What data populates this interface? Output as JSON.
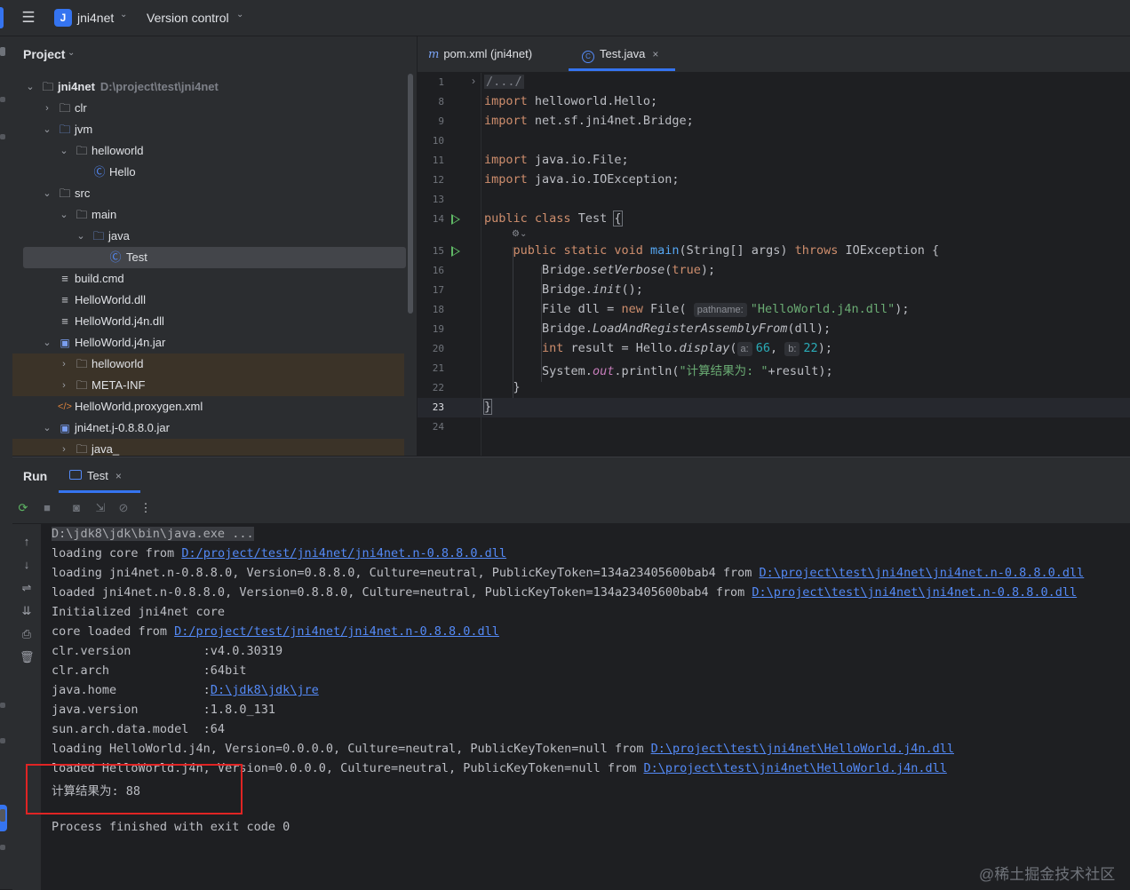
{
  "topbar": {
    "project_badge": "J",
    "project_name": "jni4net",
    "vcs_label": "Version control",
    "menu_icon": "hamburger-menu-icon",
    "chevron_icon": "chevron-down-icon"
  },
  "project_panel": {
    "title": "Project",
    "tree": [
      {
        "label": "jni4net",
        "path": "D:\\project\\test\\jni4net",
        "icon": "folder-module-icon",
        "expanded": true
      },
      {
        "label": "clr",
        "icon": "folder-icon",
        "expanded": false
      },
      {
        "label": "jvm",
        "icon": "folder-source-icon",
        "expanded": true
      },
      {
        "label": "helloworld",
        "icon": "package-icon",
        "expanded": true
      },
      {
        "label": "Hello",
        "icon": "java-class-icon"
      },
      {
        "label": "src",
        "icon": "folder-icon",
        "expanded": true
      },
      {
        "label": "main",
        "icon": "folder-icon",
        "expanded": true
      },
      {
        "label": "java",
        "icon": "folder-source-icon",
        "expanded": true
      },
      {
        "label": "Test",
        "icon": "java-class-icon",
        "selected": true
      },
      {
        "label": "build.cmd",
        "icon": "text-file-icon"
      },
      {
        "label": "HelloWorld.dll",
        "icon": "text-file-icon"
      },
      {
        "label": "HelloWorld.j4n.dll",
        "icon": "text-file-icon"
      },
      {
        "label": "HelloWorld.j4n.jar",
        "icon": "jar-icon",
        "expanded": true
      },
      {
        "label": "helloworld",
        "icon": "folder-icon",
        "expanded": false
      },
      {
        "label": "META-INF",
        "icon": "folder-icon",
        "expanded": false
      },
      {
        "label": "HelloWorld.proxygen.xml",
        "icon": "xml-file-icon"
      },
      {
        "label": "jni4net.j-0.8.8.0.jar",
        "icon": "jar-icon",
        "expanded": true
      },
      {
        "label": "java_",
        "icon": "folder-icon",
        "expanded": false
      }
    ]
  },
  "editor_tabs": [
    {
      "label": "pom.xml (jni4net)",
      "icon": "maven-icon"
    },
    {
      "label": "Test.java",
      "icon": "java-class-icon",
      "active": true,
      "close": "×"
    }
  ],
  "editor": {
    "line_numbers": [
      "1",
      "8",
      "9",
      "10",
      "11",
      "12",
      "13",
      "14",
      "15",
      "16",
      "17",
      "18",
      "19",
      "20",
      "21",
      "22",
      "23",
      "24"
    ],
    "fold_text": "/.../",
    "imports": [
      "helloworld.Hello;",
      "net.sf.jni4net.Bridge;",
      "java.io.File;",
      "java.io.IOException;"
    ],
    "import_kw": "import",
    "class_line": {
      "kw1": "public",
      "kw2": "class",
      "name": "Test",
      "brace": "{"
    },
    "main_line": {
      "kw1": "public",
      "kw2": "static",
      "kw3": "void",
      "name": "main",
      "params": "(String[] args) ",
      "kw4": "throws",
      "rest": " IOException {"
    },
    "line16": {
      "obj": "Bridge.",
      "m": "setVerbose",
      "open": "(",
      "arg": "true",
      "close": ");"
    },
    "line17": {
      "obj": "Bridge.",
      "m": "init",
      "rest": "();"
    },
    "line18": {
      "pre": "File dll = ",
      "kw": "new",
      "ctor": " File(",
      "hint": "pathname:",
      "str": "\"HelloWorld.j4n.dll\"",
      "close": ");"
    },
    "line19": {
      "obj": "Bridge.",
      "m": "LoadAndRegisterAssemblyFrom",
      "rest": "(dll);"
    },
    "line20": {
      "kw": "int",
      "pre": " result = Hello.",
      "m": "display",
      "open": "(",
      "hint_a": "a:",
      "val_a": "66",
      "sep": ", ",
      "hint_b": "b:",
      "val_b": "22",
      "close": ");"
    },
    "line21": {
      "pre": "System.",
      "fld": "out",
      "mid": ".println(",
      "str": "\"计算结果为: \"",
      "rest": "+result);"
    },
    "line22": "}",
    "line23": "}"
  },
  "run_panel": {
    "title": "Run",
    "tab_label": "Test",
    "tab_close": "×",
    "output": [
      {
        "text": "D:\\jdk8\\jdk\\bin\\java.exe ..."
      },
      {
        "text": "loading core from ",
        "link": "D:/project/test/jni4net/jni4net.n-0.8.8.0.dll"
      },
      {
        "text": "loading jni4net.n-0.8.8.0, Version=0.8.8.0, Culture=neutral, PublicKeyToken=134a23405600bab4 from ",
        "link": "D:\\project\\test\\jni4net\\jni4net.n-0.8.8.0.dll"
      },
      {
        "text": "loaded jni4net.n-0.8.8.0, Version=0.8.8.0, Culture=neutral, PublicKeyToken=134a23405600bab4 from ",
        "link": "D:\\project\\test\\jni4net\\jni4net.n-0.8.8.0.dll"
      },
      {
        "text": "Initialized jni4net core"
      },
      {
        "text": "core loaded from ",
        "link": "D:/project/test/jni4net/jni4net.n-0.8.8.0.dll"
      },
      {
        "text": "clr.version          :v4.0.30319"
      },
      {
        "text": "clr.arch             :64bit"
      },
      {
        "text": "java.home            :",
        "link": "D:\\jdk8\\jdk\\jre"
      },
      {
        "text": "java.version         :1.8.0_131"
      },
      {
        "text": "sun.arch.data.model  :64"
      },
      {
        "text": "loading HelloWorld.j4n, Version=0.0.0.0, Culture=neutral, PublicKeyToken=null from ",
        "link": "D:\\project\\test\\jni4net\\HelloWorld.j4n.dll"
      },
      {
        "text": "loaded HelloWorld.j4n, Version=0.0.0.0, Culture=neutral, PublicKeyToken=null from ",
        "link": "D:\\project\\test\\jni4net\\HelloWorld.j4n.dll"
      },
      {
        "text": "计算结果为: 88"
      },
      {
        "text": ""
      },
      {
        "text": "Process finished with exit code 0"
      }
    ]
  },
  "watermark": "@稀土掘金技术社区",
  "colors": {
    "accent": "#3574f0",
    "highlight_box": "#e02424",
    "keyword": "#cf8e6d",
    "string": "#6aab73",
    "number": "#2aacb8",
    "method": "#56a8f5"
  }
}
